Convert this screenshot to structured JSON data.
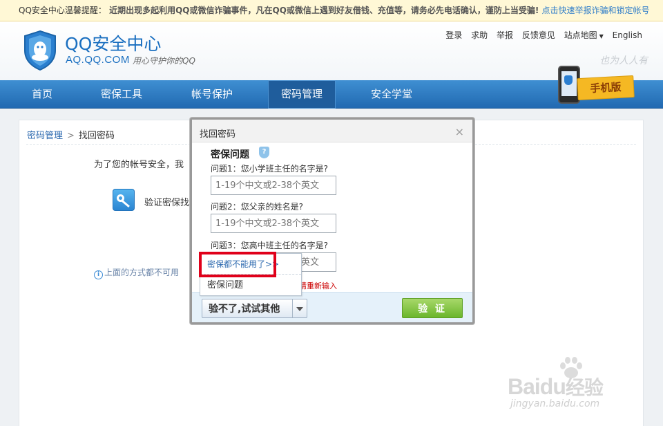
{
  "warning_bar": {
    "title": "QQ安全中心温馨提醒：",
    "message": " 近期出现多起利用QQ或微信诈骗事件，凡在QQ或微信上遇到好友借钱、充值等，请务必先电话确认，谨防上当受骗! ",
    "link": "点击快速举报诈骗和锁定帐号"
  },
  "header": {
    "logo_title": "QQ安全中心",
    "logo_domain": "AQ.QQ.COM",
    "logo_slogan": "用心守护你的QQ",
    "right_slogan": "也为人人有",
    "top_links": [
      "登录",
      "求助",
      "举报",
      "反馈意见",
      "站点地图",
      "English"
    ],
    "mobile_badge": "手机版"
  },
  "nav": {
    "items": [
      "首页",
      "密保工具",
      "帐号保护",
      "密码管理",
      "安全学堂"
    ],
    "active": "密码管理"
  },
  "page": {
    "breadcrumb_parent": "密码管理",
    "breadcrumb_sep": ">",
    "breadcrumb_current": "找回密码",
    "intro": "为了您的帐号安全，我",
    "verify_method": "验证密保找",
    "fallback_note": "上面的方式都不可用"
  },
  "dialog": {
    "title": "找回密码",
    "close_symbol": "×",
    "heading": "密保问题",
    "questions": [
      {
        "label": "问题1：您小学班主任的名字是?",
        "placeholder": "1-19个中文或2-38个英文"
      },
      {
        "label": "问题2：您父亲的姓名是?",
        "placeholder": "1-19个中文或2-38个英文"
      },
      {
        "label": "问题3：您高中班主任的名字是?",
        "placeholder": "1-19个中文或2-38个英文"
      }
    ],
    "error": "请重新输入",
    "try_other_button": "验不了,试试其他",
    "verify_button": "验 证"
  },
  "dropdown": {
    "items": [
      "密保都不能用了>>",
      "密保问题"
    ]
  },
  "watermark": {
    "text_latin": "Bai",
    "text_paw": "du",
    "text_cn": "经验",
    "url": "jingyan.baidu.com"
  }
}
